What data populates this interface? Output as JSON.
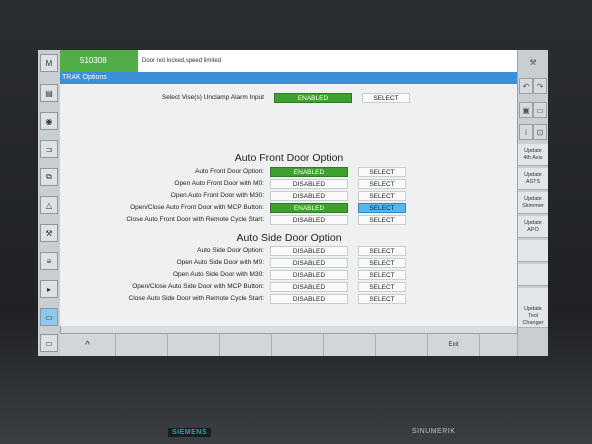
{
  "status": {
    "alarm_number": "510308",
    "alarm_text": "Door not locked,speed limited"
  },
  "window_title": "TRAK Options",
  "left_bar": {
    "items": [
      "M",
      "",
      "",
      "",
      "",
      "",
      "",
      "",
      "SINU\nMNT",
      "",
      "",
      ""
    ]
  },
  "vise": {
    "label": "Select Vise(s) Unclamp Alarm Input",
    "value": "ENABLED",
    "select": "SELECT"
  },
  "front_section": {
    "title": "Auto Front Door Option",
    "rows": [
      {
        "label": "Auto Front Door Option:",
        "value": "ENABLED",
        "select": "SELECT"
      },
      {
        "label": "Open Auto Front Door with M0:",
        "value": "DISABLED",
        "select": "SELECT"
      },
      {
        "label": "Open Auto Front Door with M30:",
        "value": "DISABLED",
        "select": "SELECT"
      },
      {
        "label": "Open/Close Auto Front Door with MCP Button:",
        "value": "ENABLED",
        "select": "SELECT"
      },
      {
        "label": "Close Auto Front Door with Remote Cycle Start:",
        "value": "DISABLED",
        "select": "SELECT"
      }
    ]
  },
  "side_section": {
    "title": "Auto Side Door Option",
    "rows": [
      {
        "label": "Auto Side Door Option:",
        "value": "DISABLED",
        "select": "SELECT"
      },
      {
        "label": "Open Auto Side Door with M0:",
        "value": "DISABLED",
        "select": "SELECT"
      },
      {
        "label": "Open Auto Side Door with M30:",
        "value": "DISABLED",
        "select": "SELECT"
      },
      {
        "label": "Open/Close Auto Side Door with MCP Button:",
        "value": "DISABLED",
        "select": "SELECT"
      },
      {
        "label": "Close Auto Side Door with Remote Cycle Start:",
        "value": "DISABLED",
        "select": "SELECT"
      }
    ]
  },
  "right_softkeys": {
    "update_4th": "Update\n4th Axis",
    "update_asts": "Update\nASTS",
    "update_skimmer": "Update\nSkimmer",
    "update_apo": "Update\nAPO",
    "update_tool_changer": "Update\nTool Changer"
  },
  "bottom_softkeys": {
    "up": "^",
    "exit": "Exit"
  },
  "brand": {
    "left": "SIEMENS",
    "right": "SINUMERIK"
  },
  "colors": {
    "enabled": "#3ea12f",
    "selected": "#58b7ea",
    "title_bar": "#3b8fd6",
    "alarm": "#4fae47"
  }
}
